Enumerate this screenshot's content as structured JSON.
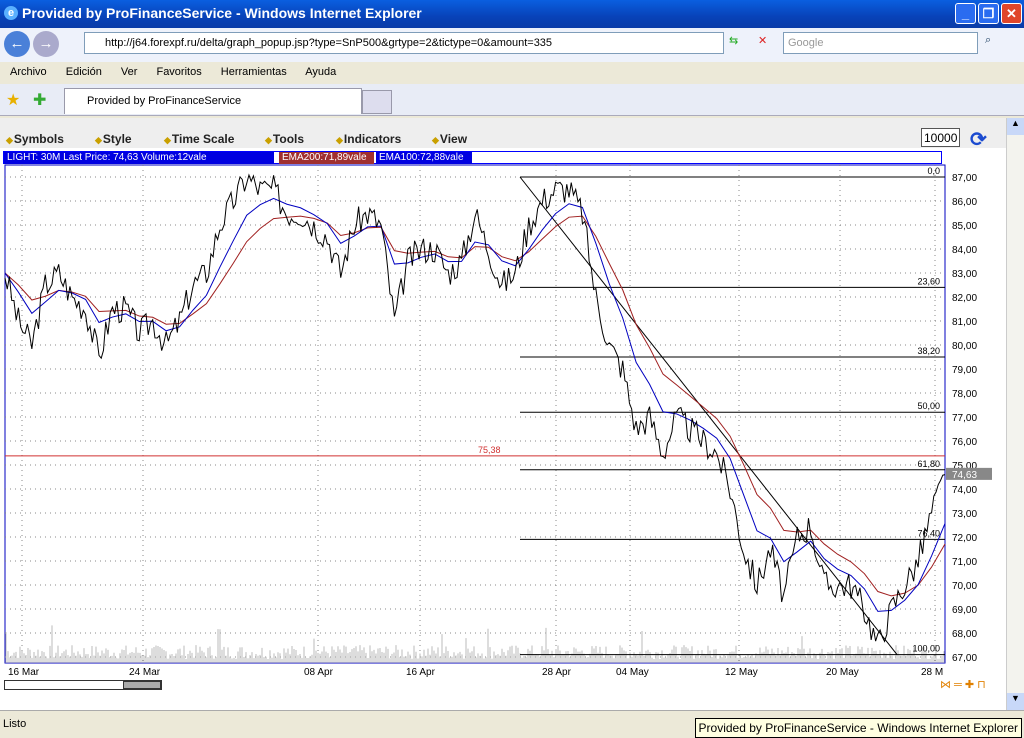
{
  "window": {
    "title": "Provided by ProFinanceService - Windows Internet Explorer",
    "min": "_",
    "max": "❐",
    "close": "✕"
  },
  "address": {
    "url": "http://j64.forexpf.ru/delta/graph_popup.jsp?type=SnP500&grtype=2&tictype=0&amount=335",
    "search_placeholder": "Google"
  },
  "menu": [
    "Archivo",
    "Edición",
    "Ver",
    "Favoritos",
    "Herramientas",
    "Ayuda"
  ],
  "tab": {
    "label": "Provided by ProFinanceService"
  },
  "toolbar": {
    "items": [
      "Symbols",
      "Style",
      "Time Scale",
      "Tools",
      "Indicators",
      "View"
    ],
    "zoom_value": "10000"
  },
  "info": {
    "main": "LIGHT: 30M Last Price: 74,63 Volume:12vale",
    "ema200": "EMA200:71,89vale",
    "ema100": "EMA100:72,88vale"
  },
  "colors": {
    "ema200": "#a02020",
    "ema100": "#0000c0",
    "price": "#000000",
    "resistance": "#d03030"
  },
  "chart_data": {
    "type": "line",
    "ylim": [
      67,
      87
    ],
    "y_ticks": [
      "87,00",
      "86,00",
      "85,00",
      "84,00",
      "83,00",
      "82,00",
      "81,00",
      "80,00",
      "79,00",
      "78,00",
      "77,00",
      "76,00",
      "75,00",
      "74,00",
      "73,00",
      "72,00",
      "71,00",
      "70,00",
      "69,00",
      "68,00",
      "67,00"
    ],
    "x_ticks": [
      "16 Mar",
      "24 Mar",
      "08 Apr",
      "16 Apr",
      "28 Apr",
      "04 May",
      "12 May",
      "20 May",
      "28 M"
    ],
    "price": [
      83,
      81,
      80,
      82.5,
      83,
      82,
      81.5,
      79.5,
      81.5,
      81.5,
      80.5,
      81,
      80,
      81,
      82.5,
      83,
      85,
      86,
      87,
      86.5,
      86.5,
      85.5,
      85.5,
      85,
      84.5,
      83,
      85,
      85.5,
      85,
      81,
      83.5,
      84,
      84,
      83,
      83.5,
      85.5,
      84,
      82.5,
      83,
      85,
      86,
      86.5,
      86.5,
      85.5,
      82,
      80,
      79,
      76.5,
      77,
      75.5,
      77,
      76.5,
      76,
      75.5,
      74,
      71.5,
      70,
      71.5,
      69.5,
      72,
      72.5,
      70,
      70,
      70,
      69,
      67.5,
      69,
      70,
      71,
      73,
      74.6
    ],
    "last_price": "74,63",
    "horizontal_line": {
      "value": 75.38,
      "label": "75,38"
    },
    "fibonacci": [
      {
        "label": "0,0",
        "value": 87.0
      },
      {
        "label": "23,60",
        "value": 82.4
      },
      {
        "label": "38,20",
        "value": 79.5
      },
      {
        "label": "50,00",
        "value": 77.2
      },
      {
        "label": "61,80",
        "value": 74.8
      },
      {
        "label": "76,40",
        "value": 71.9
      },
      {
        "label": "100,00",
        "value": 67.1
      }
    ]
  },
  "status": {
    "text": "Listo",
    "tooltip": "Provided by ProFinanceService - Windows Internet Explorer"
  }
}
